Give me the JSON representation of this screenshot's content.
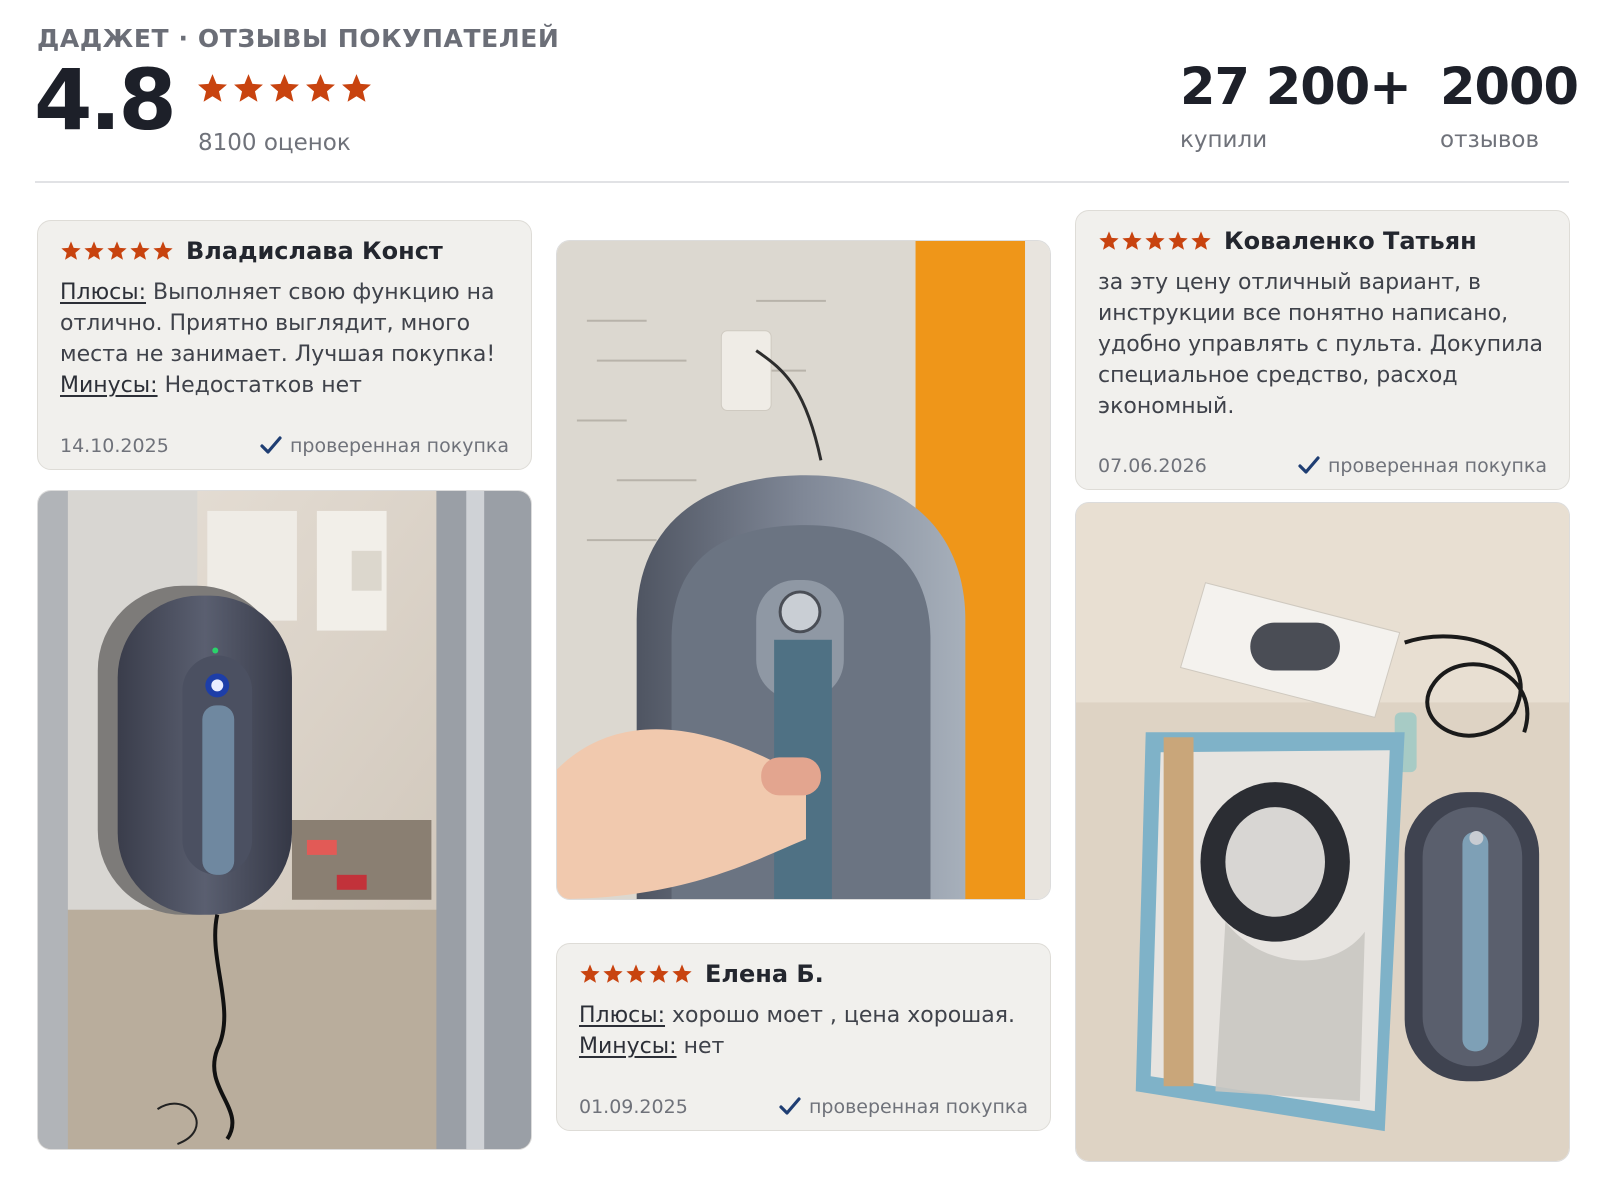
{
  "header": {
    "brand_line": "ДАДЖЕТ · ОТЗЫВЫ ПОКУПАТЕЛЕЙ",
    "rating": "4.8",
    "stars": 5,
    "rating_count": "8100 оценок",
    "stats": [
      {
        "value": "27 200+",
        "label": "купили"
      },
      {
        "value": "2000",
        "label": "отзывов"
      }
    ]
  },
  "reviews": [
    {
      "name": "Владислава Конст",
      "stars": 5,
      "pros_label": "Плюсы:",
      "pros": "Выполняет свою функцию на отлично. Приятно выглядит, много места не занимает. Лучшая покупка!",
      "cons_label": "Минусы:",
      "cons": "Недостатков нет",
      "date": "14.10.2025",
      "verified": "проверенная покупка"
    },
    {
      "name": "Коваленко Татьян",
      "stars": 5,
      "text": "за эту цену отличный вариант, в инструкции все понятно написано, удобно управлять с пульта. Докупила специальное средство, расход экономный.",
      "date": "07.06.2026",
      "verified": "проверенная покупка"
    },
    {
      "name": "Елена Б.",
      "stars": 5,
      "pros_label": "Плюсы:",
      "pros": "хорошо моет , цена хорошая.",
      "cons_label": "Минусы:",
      "cons": "нет",
      "date": "01.09.2025",
      "verified": "проверенная покупка"
    }
  ],
  "colors": {
    "star": "#c8430f",
    "check": "#1f3e73",
    "card_bg": "#f1f0ed"
  },
  "icons": {
    "star": "star-icon",
    "check": "check-icon"
  }
}
